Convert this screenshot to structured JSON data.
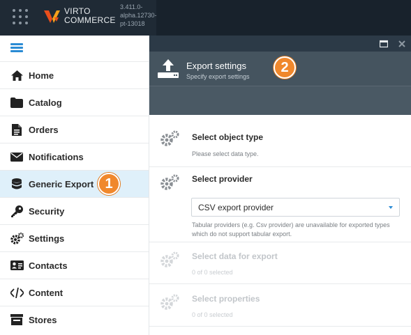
{
  "header": {
    "brand_line1": "VIRTO",
    "brand_line2": "COMMERCE",
    "version": "3.411.0-alpha.12730-pt-13018",
    "icons": {
      "apps": "grid-icon",
      "logo": "virto-logo"
    }
  },
  "sidebar": {
    "toggle_icon": "hamburger-icon",
    "items": [
      {
        "label": "Home",
        "icon": "home-icon"
      },
      {
        "label": "Catalog",
        "icon": "folder-icon"
      },
      {
        "label": "Orders",
        "icon": "document-icon"
      },
      {
        "label": "Notifications",
        "icon": "envelope-icon"
      },
      {
        "label": "Generic Export",
        "icon": "database-icon",
        "active": true
      },
      {
        "label": "Security",
        "icon": "key-icon"
      },
      {
        "label": "Settings",
        "icon": "gears-icon"
      },
      {
        "label": "Contacts",
        "icon": "contact-card-icon"
      },
      {
        "label": "Content",
        "icon": "code-icon"
      },
      {
        "label": "Stores",
        "icon": "store-icon"
      }
    ],
    "callout": "1"
  },
  "blade": {
    "title": "Export settings",
    "subtitle": "Specify export settings",
    "callout": "2",
    "icons": {
      "header": "upload-icon",
      "maximize": "maximize-icon",
      "close": "close-icon"
    },
    "steps": [
      {
        "title": "Select object type",
        "description": "Please select data type.",
        "enabled": true
      },
      {
        "title": "Select provider",
        "enabled": true,
        "provider": {
          "selected": "CSV export provider"
        },
        "help": "Tabular providers (e.g. Csv provider) are unavailable for exported types which do not support tabular export."
      },
      {
        "title": "Select data for export",
        "description": "0 of 0 selected",
        "enabled": false
      },
      {
        "title": "Select properties",
        "description": "0 of 0 selected",
        "enabled": false
      }
    ]
  },
  "colors": {
    "topbar": "#1e2a36",
    "accent": "#2a8bd4",
    "callout": "#f0882c",
    "active_item": "#dff0fa",
    "blade_header": "#45545f"
  }
}
